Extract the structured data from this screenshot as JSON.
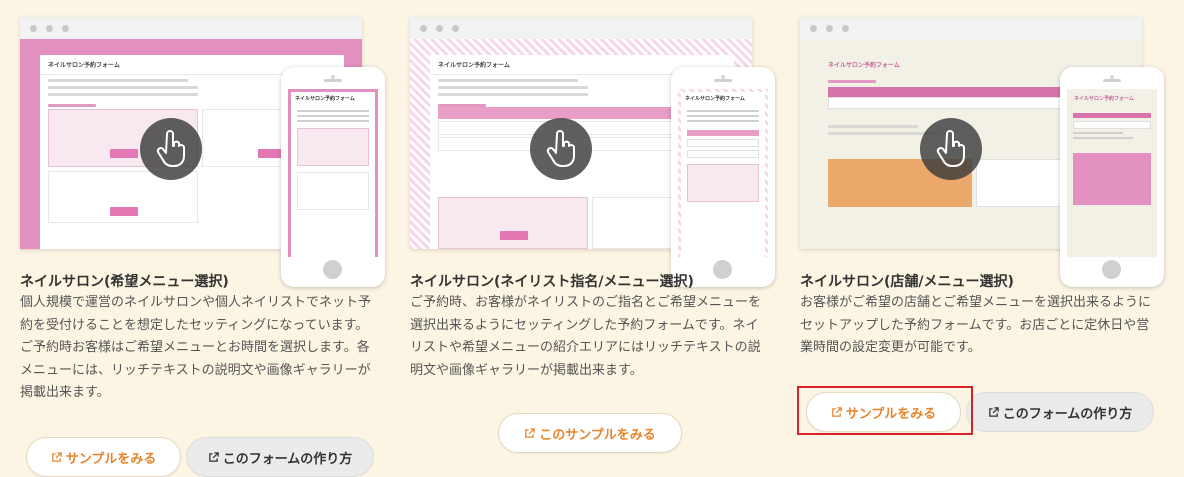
{
  "colors": {
    "background": "#fdf5e4",
    "accent_orange": "#e8842c",
    "pink": "#e377b3",
    "highlight_red": "#d6232a"
  },
  "cards": [
    {
      "screenshot": {
        "form_title": "ネイルサロン予約フォーム",
        "phone_form_title": "ネイルサロン予約フォーム"
      },
      "title": "ネイルサロン(希望メニュー選択)",
      "description": "個人規模で運営のネイルサロンや個人ネイリストでネット予約を受付けることを想定したセッティングになっています。ご予約時お客様はご希望メニューとお時間を選択します。各メニューには、リッチテキストの説明文や画像ギャラリーが掲載出来ます。",
      "primary_button": "サンプルをみる",
      "secondary_button": "このフォームの作り方"
    },
    {
      "screenshot": {
        "form_title": "ネイルサロン予約フォーム",
        "phone_form_title": "ネイルサロン予約フォーム"
      },
      "title": "ネイルサロン(ネイリスト指名/メニュー選択)",
      "description": "ご予約時、お客様がネイリストのご指名とご希望メニューを選択出来るようにセッティングした予約フォームです。ネイリストや希望メニューの紹介エリアにはリッチテキストの説明文や画像ギャラリーが掲載出来ます。",
      "primary_button": "このサンプルをみる"
    },
    {
      "screenshot": {
        "form_title": "ネイルサロン予約フォーム",
        "phone_form_title": "ネイルサロン予約フォーム"
      },
      "title": "ネイルサロン(店舗/メニュー選択)",
      "description": "お客様がご希望の店舗とご希望メニューを選択出来るようにセットアップした予約フォームです。お店ごとに定休日や営業時間の設定変更が可能です。",
      "primary_button": "サンプルをみる",
      "secondary_button": "このフォームの作り方"
    }
  ],
  "icons": {
    "pointer": "hand-pointer-icon",
    "external_link": "external-link-icon"
  }
}
